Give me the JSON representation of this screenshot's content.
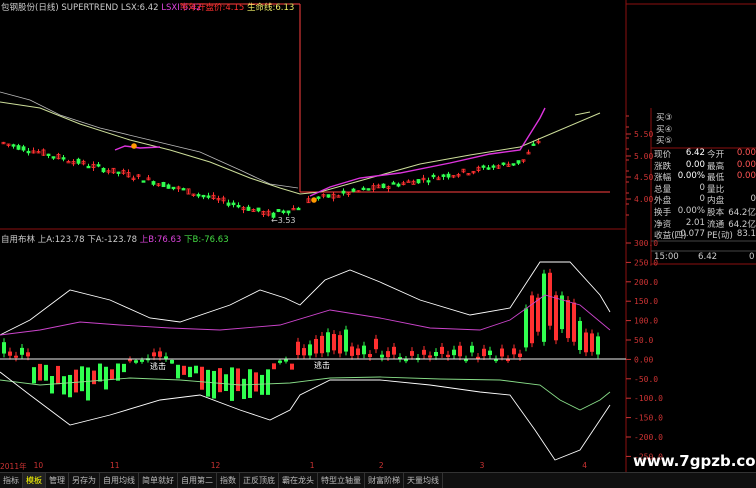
{
  "top_header": {
    "stock": "包钢股份(日线)",
    "indicator": "SUPERTREND",
    "lsx_label": "LSX:",
    "lsx_value": "6.42",
    "lsxi_label": "LSXI:",
    "lsxi_value": "6.42",
    "half_year_label": "半年开盘价:",
    "half_year_value": "4.15",
    "life_label": "生命线:",
    "life_value": "6.13"
  },
  "bottom_header": {
    "name": "自用布林",
    "sa_label": "上A:",
    "sa_value": "123.78",
    "xa_label": "下A:",
    "xa_value": "-123.78",
    "sb_label": "上B:",
    "sb_value": "76.63",
    "xb_label": "下B:",
    "xb_value": "-76.63"
  },
  "annotations": {
    "min_price": "3.53",
    "dd1": "逃击",
    "dd2": "逃击"
  },
  "price_axis": [
    "5.50",
    "5.00",
    "4.50",
    "4.00"
  ],
  "order_book": [
    "买③",
    "买④",
    "买⑤"
  ],
  "osc_axis": [
    "300.0",
    "250.0",
    "200.0",
    "150.0",
    "100.0",
    "50.0",
    "0.00",
    "-50.0",
    "-100.0",
    "-150.0",
    "-200.0",
    "-250.0"
  ],
  "quote_panel": [
    {
      "l1": "现价",
      "v1": "6.42",
      "l2": "今开",
      "v2": "0.00"
    },
    {
      "l1": "涨跌",
      "v1": "0.00",
      "l2": "最高",
      "v2": "0.00"
    },
    {
      "l1": "涨幅",
      "v1": "0.00%",
      "l2": "最低",
      "v2": "0.00"
    },
    {
      "l1": "总量",
      "v1": "0",
      "l2": "量比",
      "v2": ""
    },
    {
      "l1": "外盘",
      "v1": "0",
      "l2": "内盘",
      "v2": "0"
    },
    {
      "l1": "换手",
      "v1": "0.00%",
      "l2": "股本",
      "v2": "64.2亿"
    },
    {
      "l1": "净资",
      "v1": "2.01",
      "l2": "流通",
      "v2": "64.2亿"
    },
    {
      "l1": "收益(四)",
      "v1": "0.077",
      "l2": "PE(动)",
      "v2": "83.1"
    }
  ],
  "tick": {
    "time": "15:00",
    "price": "6.42",
    "vol": "0"
  },
  "timeline": [
    {
      "label": "2011年",
      "pos": 0.0
    },
    {
      "label": "10",
      "pos": 0.055
    },
    {
      "label": "11",
      "pos": 0.18
    },
    {
      "label": "12",
      "pos": 0.345
    },
    {
      "label": "1",
      "pos": 0.507
    },
    {
      "label": "2",
      "pos": 0.62
    },
    {
      "label": "3",
      "pos": 0.785
    },
    {
      "label": "4",
      "pos": 0.953
    }
  ],
  "tabs": [
    "指标",
    "模板",
    "管理",
    "另存为",
    "自用均线",
    "简单就好",
    "自用第二",
    "指数",
    "正反顶底",
    "霸在龙头",
    "特型立轴量",
    "财富阶梯",
    "天量均线"
  ],
  "active_tab": 1,
  "watermark": "www.7gpzb.com",
  "colors": {
    "up": "#ff3030",
    "down": "#30ff50",
    "supertrend": "#dd33dd",
    "life": "#ccdd99",
    "boll": "#ffffff"
  }
}
